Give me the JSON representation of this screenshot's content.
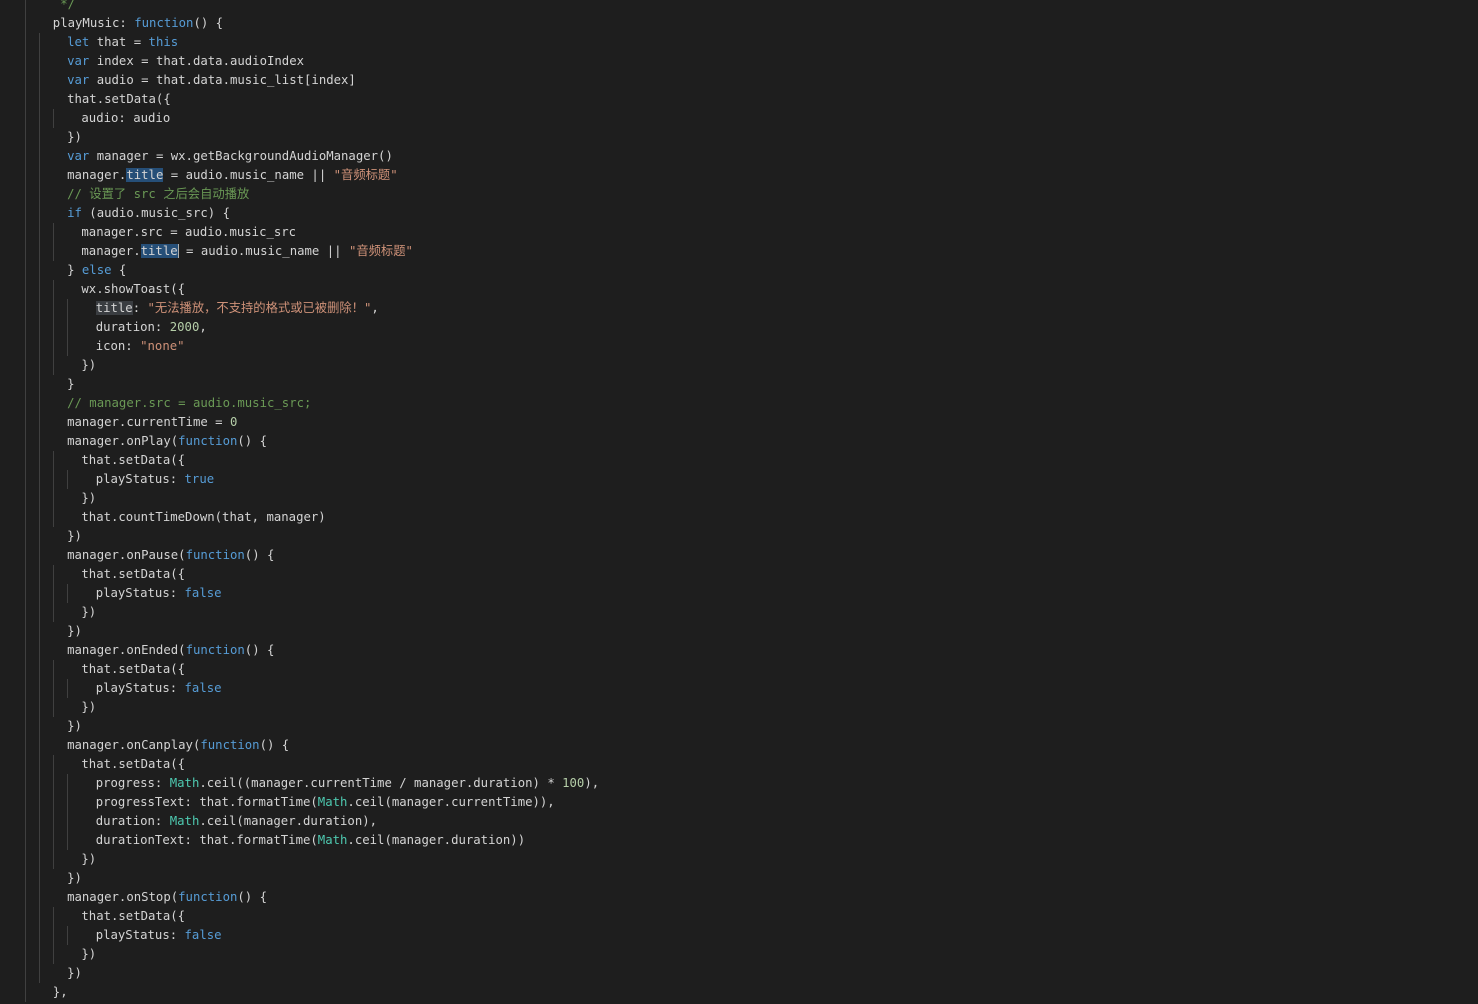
{
  "editor": {
    "theme_colors": {
      "background": "#1e1e1e",
      "default_text": "#d4d4d4",
      "keyword": "#569cd6",
      "string": "#ce9178",
      "comment": "#6a9955",
      "number": "#b5cea8",
      "class": "#4ec9b0",
      "selection": "#264f78",
      "indent_guide": "#404040"
    },
    "lines": [
      {
        "indent": 1,
        "segments": [
          {
            "t": " */",
            "c": "cmt"
          }
        ]
      },
      {
        "indent": 1,
        "segments": [
          {
            "t": "playMusic: ",
            "c": "plain"
          },
          {
            "t": "function",
            "c": "kw"
          },
          {
            "t": "() {",
            "c": "plain"
          }
        ]
      },
      {
        "indent": 2,
        "segments": [
          {
            "t": "let",
            "c": "kw"
          },
          {
            "t": " that = ",
            "c": "plain"
          },
          {
            "t": "this",
            "c": "kw"
          }
        ]
      },
      {
        "indent": 2,
        "segments": [
          {
            "t": "var",
            "c": "kw"
          },
          {
            "t": " index = that.data.audioIndex",
            "c": "plain"
          }
        ]
      },
      {
        "indent": 2,
        "segments": [
          {
            "t": "var",
            "c": "kw"
          },
          {
            "t": " audio = that.data.music_list[index]",
            "c": "plain"
          }
        ]
      },
      {
        "indent": 2,
        "segments": [
          {
            "t": "that.setData({",
            "c": "plain"
          }
        ]
      },
      {
        "indent": 3,
        "segments": [
          {
            "t": "audio: audio",
            "c": "plain"
          }
        ]
      },
      {
        "indent": 2,
        "segments": [
          {
            "t": "})",
            "c": "plain"
          }
        ]
      },
      {
        "indent": 2,
        "segments": [
          {
            "t": "var",
            "c": "kw"
          },
          {
            "t": " manager = wx.getBackgroundAudioManager()",
            "c": "plain"
          }
        ]
      },
      {
        "indent": 2,
        "segments": [
          {
            "t": "manager.",
            "c": "plain"
          },
          {
            "t": "title",
            "c": "plain",
            "hl": "sel"
          },
          {
            "t": " = audio.music_name || ",
            "c": "plain"
          },
          {
            "t": "\"音频标题\"",
            "c": "str"
          }
        ]
      },
      {
        "indent": 2,
        "segments": [
          {
            "t": "// 设置了 src 之后会自动播放",
            "c": "cmt"
          }
        ]
      },
      {
        "indent": 2,
        "segments": [
          {
            "t": "if",
            "c": "kw"
          },
          {
            "t": " (audio.music_src) {",
            "c": "plain"
          }
        ]
      },
      {
        "indent": 3,
        "segments": [
          {
            "t": "manager.src = audio.music_src",
            "c": "plain"
          }
        ]
      },
      {
        "indent": 3,
        "segments": [
          {
            "t": "manager.",
            "c": "plain"
          },
          {
            "t": "title",
            "c": "plain",
            "hl": "sel",
            "cursor": true
          },
          {
            "t": " = audio.music_name || ",
            "c": "plain"
          },
          {
            "t": "\"音频标题\"",
            "c": "str"
          }
        ]
      },
      {
        "indent": 2,
        "segments": [
          {
            "t": "} ",
            "c": "plain"
          },
          {
            "t": "else",
            "c": "kw"
          },
          {
            "t": " {",
            "c": "plain"
          }
        ]
      },
      {
        "indent": 3,
        "segments": [
          {
            "t": "wx.showToast({",
            "c": "plain"
          }
        ]
      },
      {
        "indent": 4,
        "segments": [
          {
            "t": "title",
            "c": "plain",
            "hl": "occ"
          },
          {
            "t": ": ",
            "c": "plain"
          },
          {
            "t": "\"无法播放，不支持的格式或已被删除！\"",
            "c": "str"
          },
          {
            "t": ",",
            "c": "plain"
          }
        ]
      },
      {
        "indent": 4,
        "segments": [
          {
            "t": "duration: ",
            "c": "plain"
          },
          {
            "t": "2000",
            "c": "num"
          },
          {
            "t": ",",
            "c": "plain"
          }
        ]
      },
      {
        "indent": 4,
        "segments": [
          {
            "t": "icon: ",
            "c": "plain"
          },
          {
            "t": "\"none\"",
            "c": "str"
          }
        ]
      },
      {
        "indent": 3,
        "segments": [
          {
            "t": "})",
            "c": "plain"
          }
        ]
      },
      {
        "indent": 2,
        "segments": [
          {
            "t": "}",
            "c": "plain"
          }
        ]
      },
      {
        "indent": 2,
        "segments": [
          {
            "t": "// manager.src = audio.music_src;",
            "c": "cmt"
          }
        ]
      },
      {
        "indent": 2,
        "segments": [
          {
            "t": "manager.currentTime = ",
            "c": "plain"
          },
          {
            "t": "0",
            "c": "num"
          }
        ]
      },
      {
        "indent": 2,
        "segments": [
          {
            "t": "manager.onPlay(",
            "c": "plain"
          },
          {
            "t": "function",
            "c": "kw"
          },
          {
            "t": "() {",
            "c": "plain"
          }
        ]
      },
      {
        "indent": 3,
        "segments": [
          {
            "t": "that.setData({",
            "c": "plain"
          }
        ]
      },
      {
        "indent": 4,
        "segments": [
          {
            "t": "playStatus: ",
            "c": "plain"
          },
          {
            "t": "true",
            "c": "kw"
          }
        ]
      },
      {
        "indent": 3,
        "segments": [
          {
            "t": "})",
            "c": "plain"
          }
        ]
      },
      {
        "indent": 3,
        "segments": [
          {
            "t": "that.countTimeDown(that, manager)",
            "c": "plain"
          }
        ]
      },
      {
        "indent": 2,
        "segments": [
          {
            "t": "})",
            "c": "plain"
          }
        ]
      },
      {
        "indent": 2,
        "segments": [
          {
            "t": "manager.onPause(",
            "c": "plain"
          },
          {
            "t": "function",
            "c": "kw"
          },
          {
            "t": "() {",
            "c": "plain"
          }
        ]
      },
      {
        "indent": 3,
        "segments": [
          {
            "t": "that.setData({",
            "c": "plain"
          }
        ]
      },
      {
        "indent": 4,
        "segments": [
          {
            "t": "playStatus: ",
            "c": "plain"
          },
          {
            "t": "false",
            "c": "kw"
          }
        ]
      },
      {
        "indent": 3,
        "segments": [
          {
            "t": "})",
            "c": "plain"
          }
        ]
      },
      {
        "indent": 2,
        "segments": [
          {
            "t": "})",
            "c": "plain"
          }
        ]
      },
      {
        "indent": 2,
        "segments": [
          {
            "t": "manager.onEnded(",
            "c": "plain"
          },
          {
            "t": "function",
            "c": "kw"
          },
          {
            "t": "() {",
            "c": "plain"
          }
        ]
      },
      {
        "indent": 3,
        "segments": [
          {
            "t": "that.setData({",
            "c": "plain"
          }
        ]
      },
      {
        "indent": 4,
        "segments": [
          {
            "t": "playStatus: ",
            "c": "plain"
          },
          {
            "t": "false",
            "c": "kw"
          }
        ]
      },
      {
        "indent": 3,
        "segments": [
          {
            "t": "})",
            "c": "plain"
          }
        ]
      },
      {
        "indent": 2,
        "segments": [
          {
            "t": "})",
            "c": "plain"
          }
        ]
      },
      {
        "indent": 2,
        "segments": [
          {
            "t": "manager.onCanplay(",
            "c": "plain"
          },
          {
            "t": "function",
            "c": "kw"
          },
          {
            "t": "() {",
            "c": "plain"
          }
        ]
      },
      {
        "indent": 3,
        "segments": [
          {
            "t": "that.setData({",
            "c": "plain"
          }
        ]
      },
      {
        "indent": 4,
        "segments": [
          {
            "t": "progress: ",
            "c": "plain"
          },
          {
            "t": "Math",
            "c": "cls"
          },
          {
            "t": ".ceil((manager.currentTime / manager.duration) * ",
            "c": "plain"
          },
          {
            "t": "100",
            "c": "num"
          },
          {
            "t": "),",
            "c": "plain"
          }
        ]
      },
      {
        "indent": 4,
        "segments": [
          {
            "t": "progressText: that.formatTime(",
            "c": "plain"
          },
          {
            "t": "Math",
            "c": "cls"
          },
          {
            "t": ".ceil(manager.currentTime)),",
            "c": "plain"
          }
        ]
      },
      {
        "indent": 4,
        "segments": [
          {
            "t": "duration: ",
            "c": "plain"
          },
          {
            "t": "Math",
            "c": "cls"
          },
          {
            "t": ".ceil(manager.duration),",
            "c": "plain"
          }
        ]
      },
      {
        "indent": 4,
        "segments": [
          {
            "t": "durationText: that.formatTime(",
            "c": "plain"
          },
          {
            "t": "Math",
            "c": "cls"
          },
          {
            "t": ".ceil(manager.duration))",
            "c": "plain"
          }
        ]
      },
      {
        "indent": 3,
        "segments": [
          {
            "t": "})",
            "c": "plain"
          }
        ]
      },
      {
        "indent": 2,
        "segments": [
          {
            "t": "})",
            "c": "plain"
          }
        ]
      },
      {
        "indent": 2,
        "segments": [
          {
            "t": "manager.onStop(",
            "c": "plain"
          },
          {
            "t": "function",
            "c": "kw"
          },
          {
            "t": "() {",
            "c": "plain"
          }
        ]
      },
      {
        "indent": 3,
        "segments": [
          {
            "t": "that.setData({",
            "c": "plain"
          }
        ]
      },
      {
        "indent": 4,
        "segments": [
          {
            "t": "playStatus: ",
            "c": "plain"
          },
          {
            "t": "false",
            "c": "kw"
          }
        ]
      },
      {
        "indent": 3,
        "segments": [
          {
            "t": "})",
            "c": "plain"
          }
        ]
      },
      {
        "indent": 2,
        "segments": [
          {
            "t": "})",
            "c": "plain"
          }
        ]
      },
      {
        "indent": 1,
        "segments": [
          {
            "t": "},",
            "c": "plain"
          }
        ]
      }
    ]
  }
}
